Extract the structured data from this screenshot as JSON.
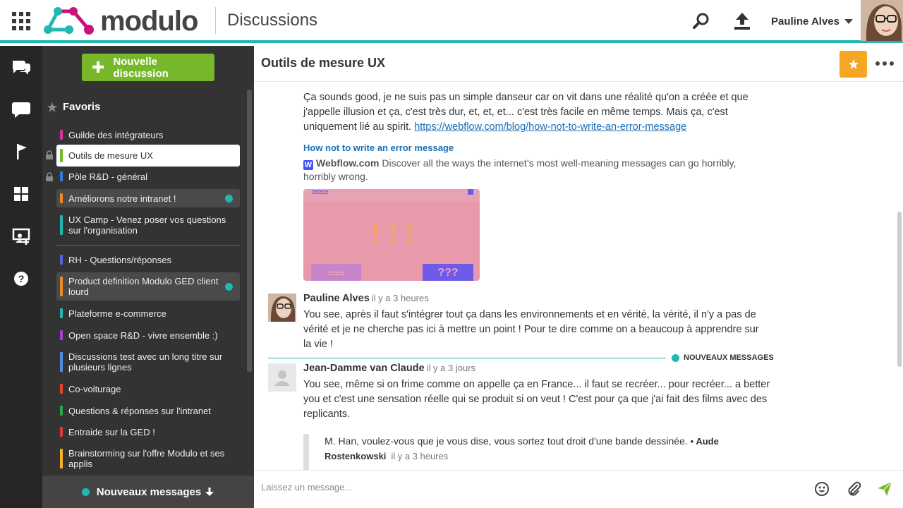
{
  "app": {
    "name": "modulo",
    "section": "Discussions"
  },
  "user": {
    "name": "Pauline Alves"
  },
  "colors": {
    "accent": "#1fb8b2",
    "new_button": "#76b82a",
    "star": "#f5a623",
    "link": "#1a6fb5"
  },
  "sidebar": {
    "new_discussion_label": "Nouvelle discussion",
    "favorites_label": "Favoris",
    "items": [
      {
        "label": "Guilde des intégrateurs",
        "color": "#d6339c"
      },
      {
        "label": "Outils de mesure UX",
        "color": "#76b82a",
        "active": true,
        "locked": true
      },
      {
        "label": "Pôle R&D - général",
        "color": "#2d7fd6",
        "locked": true
      },
      {
        "label": "Améliorons notre intranet !",
        "color": "#f08a24",
        "unread": true
      },
      {
        "label": "UX Camp - Venez poser vos questions sur l'organisation",
        "color": "#1fb8b2"
      },
      {
        "label": "RH - Questions/réponses",
        "color": "#5b5fe0"
      },
      {
        "label": "Product definition Modulo GED client lourd",
        "color": "#f08a24",
        "unread": true
      },
      {
        "label": "Plateforme e-commerce",
        "color": "#1fb8b2"
      },
      {
        "label": "Open space R&D - vivre ensemble :)",
        "color": "#a33fd6"
      },
      {
        "label": "Discussions test avec un long titre sur plusieurs lignes",
        "color": "#4d8fe0"
      },
      {
        "label": "Co-voiturage",
        "color": "#e8442c"
      },
      {
        "label": "Questions & réponses sur l'intranet",
        "color": "#2aa84a"
      },
      {
        "label": "Entraide sur la GED !",
        "color": "#e03a3a"
      },
      {
        "label": "Brainstorming sur l'offre Modulo et ses applis",
        "color": "#f5b324"
      }
    ],
    "new_messages_label": "Nouveaux messages"
  },
  "discussion": {
    "title": "Outils de mesure UX",
    "message1": {
      "text_line1": "Ça sounds good, je ne suis pas un simple danseur car on vit dans une réalité qu'on a créée et que",
      "text_line2": "j'appelle illusion et ça, c'est très dur, et, et, et... c'est très facile en même temps. Mais ça, c'est",
      "text_line3": "uniquement lié au spirit.",
      "link": "https://webflow.com/blog/how-not-to-write-an-error-message",
      "preview_title": "How not to write an error message",
      "preview_site": "Webflow.com",
      "preview_desc": "Discover all the ways the internet’s most well-meaning messages can go horribly, horribly wrong.",
      "preview_marks": {
        "top": "≈≈≈",
        "center": "! ! !",
        "bottom_left": "≈≈≈",
        "bottom_right": "???"
      }
    },
    "message2": {
      "author": "Pauline Alves",
      "time": "il y a 3 heures",
      "line1": "You see, après il faut s'intégrer tout ça dans les environnements et en vérité, la vérité, il n'y a pas de",
      "line2": "vérité et je ne cherche pas ici à mettre un point ! Pour te dire comme on a beaucoup à apprendre sur",
      "line3": "la vie !"
    },
    "new_messages_divider": "NOUVEAUX MESSAGES",
    "message3": {
      "author": "Jean-Damme van Claude",
      "time": "il y a 3 jours",
      "line1": "You see, même si on frime comme on appelle ça en France... il faut se recréer... pour recréer... a better",
      "line2": "you et c'est une sensation réelle qui se produit si on veut ! C'est pour ça que j'ai fait des films avec des",
      "line3": "replicants.",
      "quote_text": "M. Han, voulez-vous que je vous dise, vous sortez tout droit d'une bande dessinée.",
      "quote_author_part1": "• Aude",
      "quote_author_part2": "Rostenkowski",
      "quote_time": "il y a 3 heures"
    }
  },
  "composer": {
    "placeholder": "Laissez un message..."
  }
}
